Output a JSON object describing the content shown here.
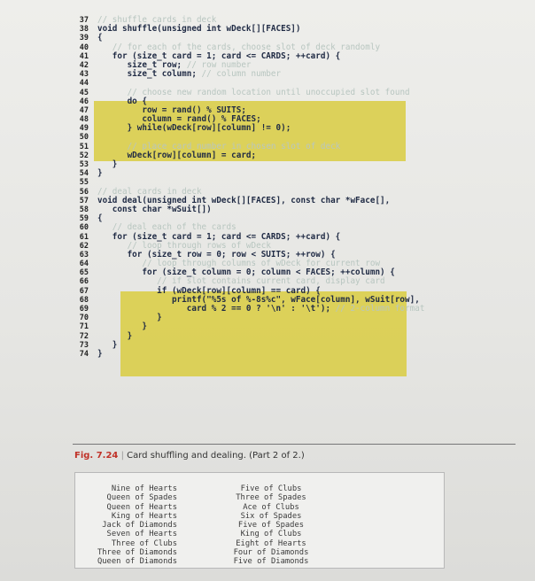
{
  "code_lines": [
    {
      "num": "37",
      "pre": "",
      "comment": "// shuffle cards in deck",
      "post": ""
    },
    {
      "num": "38",
      "pre": "void shuffle(unsigned int wDeck[][FACES])",
      "comment": "",
      "post": ""
    },
    {
      "num": "39",
      "pre": "{",
      "comment": "",
      "post": ""
    },
    {
      "num": "40",
      "pre": "   ",
      "comment": "// for each of the cards, choose slot of deck randomly",
      "post": ""
    },
    {
      "num": "41",
      "pre": "   for (size_t card = 1; card <= CARDS; ++card) {",
      "comment": "",
      "post": ""
    },
    {
      "num": "42",
      "pre": "      size_t row; ",
      "comment": "// row number",
      "post": ""
    },
    {
      "num": "43",
      "pre": "      size_t column; ",
      "comment": "// column number",
      "post": ""
    },
    {
      "num": "44",
      "pre": "",
      "comment": "",
      "post": ""
    },
    {
      "num": "45",
      "pre": "      ",
      "comment": "// choose new random location until unoccupied slot found",
      "post": ""
    },
    {
      "num": "46",
      "pre": "      do {",
      "comment": "",
      "post": ""
    },
    {
      "num": "47",
      "pre": "         row = rand() % SUITS;",
      "comment": "",
      "post": ""
    },
    {
      "num": "48",
      "pre": "         column = rand() % FACES;",
      "comment": "",
      "post": ""
    },
    {
      "num": "49",
      "pre": "      } while(wDeck[row][column] != 0);",
      "comment": "",
      "post": ""
    },
    {
      "num": "50",
      "pre": "",
      "comment": "",
      "post": ""
    },
    {
      "num": "51",
      "pre": "      ",
      "comment": "// place card number in chosen slot of deck",
      "post": ""
    },
    {
      "num": "52",
      "pre": "      wDeck[row][column] = card;",
      "comment": "",
      "post": ""
    },
    {
      "num": "53",
      "pre": "   }",
      "comment": "",
      "post": ""
    },
    {
      "num": "54",
      "pre": "}",
      "comment": "",
      "post": ""
    },
    {
      "num": "55",
      "pre": "",
      "comment": "",
      "post": ""
    },
    {
      "num": "56",
      "pre": "",
      "comment": "// deal cards in deck",
      "post": ""
    },
    {
      "num": "57",
      "pre": "void deal(unsigned int wDeck[][FACES], const char *wFace[],",
      "comment": "",
      "post": ""
    },
    {
      "num": "58",
      "pre": "   const char *wSuit[])",
      "comment": "",
      "post": ""
    },
    {
      "num": "59",
      "pre": "{",
      "comment": "",
      "post": ""
    },
    {
      "num": "60",
      "pre": "   ",
      "comment": "// deal each of the cards",
      "post": ""
    },
    {
      "num": "61",
      "pre": "   for (size_t card = 1; card <= CARDS; ++card) {",
      "comment": "",
      "post": ""
    },
    {
      "num": "62",
      "pre": "      ",
      "comment": "// loop through rows of wDeck",
      "post": ""
    },
    {
      "num": "63",
      "pre": "      for (size_t row = 0; row < SUITS; ++row) {",
      "comment": "",
      "post": ""
    },
    {
      "num": "64",
      "pre": "         ",
      "comment": "// loop through columns of wDeck for current row",
      "post": ""
    },
    {
      "num": "65",
      "pre": "         for (size_t column = 0; column < FACES; ++column) {",
      "comment": "",
      "post": ""
    },
    {
      "num": "66",
      "pre": "            ",
      "comment": "// if slot contains current card, display card",
      "post": ""
    },
    {
      "num": "67",
      "pre": "            if (wDeck[row][column] == card) {",
      "comment": "",
      "post": ""
    },
    {
      "num": "68",
      "pre": "               printf(\"%5s of %-8s%c\", wFace[column], wSuit[row],",
      "comment": "",
      "post": ""
    },
    {
      "num": "69",
      "pre": "                  card % 2 == 0 ? '\\n' : '\\t'); ",
      "comment": "// 2-column format",
      "post": ""
    },
    {
      "num": "70",
      "pre": "            }",
      "comment": "",
      "post": ""
    },
    {
      "num": "71",
      "pre": "         }",
      "comment": "",
      "post": ""
    },
    {
      "num": "72",
      "pre": "      }",
      "comment": "",
      "post": ""
    },
    {
      "num": "73",
      "pre": "   }",
      "comment": "",
      "post": ""
    },
    {
      "num": "74",
      "pre": "}",
      "comment": "",
      "post": ""
    }
  ],
  "caption": {
    "figure": "Fig. 7.24",
    "text": "Card shuffling and dealing. (Part 2 of 2.)"
  },
  "output": {
    "left": [
      "Nine of Hearts",
      "Queen of Spades",
      "Queen of Hearts",
      "King of Hearts",
      "Jack of Diamonds",
      "Seven of Hearts",
      "Three of Clubs",
      "Three of Diamonds",
      "Queen of Diamonds"
    ],
    "right": [
      "Five of Clubs",
      "Three of Spades",
      "Ace of Clubs",
      "Six of Spades",
      "Five of Spades",
      "King of Clubs",
      "Eight of Hearts",
      "Four of Diamonds",
      "Five of Diamonds"
    ]
  }
}
